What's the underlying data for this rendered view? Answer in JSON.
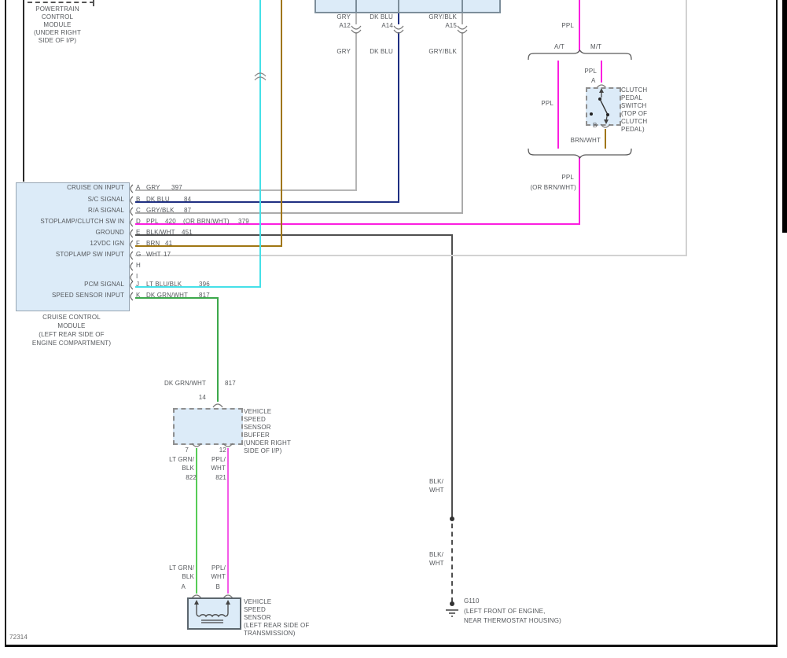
{
  "sheet_number": "72314",
  "pcm": {
    "label_lines": [
      "POWERTRAIN",
      "CONTROL",
      "MODULE",
      "(UNDER RIGHT",
      "SIDE OF I/P)"
    ]
  },
  "pcm_connector": {
    "pins": [
      {
        "color": "GRY",
        "pin": "A12",
        "wire_label": "GRY"
      },
      {
        "color": "DK BLU",
        "pin": "A14",
        "wire_label": "DK BLU"
      },
      {
        "color": "GRY/BLK",
        "pin": "A15",
        "wire_label": "GRY/BLK"
      }
    ]
  },
  "top_right": {
    "ppl_top": "PPL",
    "at_label": "A/T",
    "mt_label": "M/T",
    "ppl_at_branch": "PPL",
    "ppl_mt_branch": "PPL",
    "pin_a": "A",
    "pin_b": "B",
    "brn_wht": "BRN/WHT",
    "clutch_switch_lines": [
      "CLUTCH",
      "PEDAL",
      "SWITCH",
      "(TOP OF",
      "CLUTCH",
      "PEDAL)"
    ],
    "merge_color": "PPL",
    "merge_alt": "(OR BRN/WHT)"
  },
  "module": {
    "rows": [
      {
        "function": "CRUISE ON INPUT",
        "pin": "A",
        "color": "GRY",
        "circuit": "397"
      },
      {
        "function": "S/C SIGNAL",
        "pin": "B",
        "color": "DK BLU",
        "circuit": "84"
      },
      {
        "function": "R/A SIGNAL",
        "pin": "C",
        "color": "GRY/BLK",
        "circuit": "87"
      },
      {
        "function": "STOPLAMP/CLUTCH SW IN",
        "pin": "D",
        "color": "PPL",
        "circuit": "420",
        "alt_color": "(OR BRN/WHT)",
        "alt_circuit": "379"
      },
      {
        "function": "GROUND",
        "pin": "E",
        "color": "BLK/WHT",
        "circuit": "451"
      },
      {
        "function": "12VDC IGN",
        "pin": "F",
        "color": "BRN",
        "circuit": "41"
      },
      {
        "function": "STOPLAMP SW INPUT",
        "pin": "G",
        "color": "WHT",
        "circuit": "17"
      },
      {
        "function": "",
        "pin": "H",
        "color": "",
        "circuit": ""
      },
      {
        "function": "",
        "pin": "I",
        "color": "",
        "circuit": ""
      },
      {
        "function": "PCM SIGNAL",
        "pin": "J",
        "color": "LT BLU/BLK",
        "circuit": "396"
      },
      {
        "function": "SPEED SENSOR INPUT",
        "pin": "K",
        "color": "DK GRN/WHT",
        "circuit": "817"
      }
    ],
    "caption_lines": [
      "CRUISE CONTROL",
      "MODULE",
      "(LEFT REAR SIDE OF",
      "ENGINE COMPARTMENT)"
    ]
  },
  "vss_buffer": {
    "in_color": "DK GRN/WHT",
    "in_circuit": "817",
    "in_pin": "14",
    "label_lines": [
      "VEHICLE",
      "SPEED",
      "SENSOR",
      "BUFFER",
      "(UNDER RIGHT",
      "SIDE OF I/P)"
    ],
    "out_left_pin": "7",
    "out_right_pin": "12",
    "out_left_color_1": "LT GRN/",
    "out_left_color_2": "BLK",
    "out_left_circuit": "822",
    "out_right_color_1": "PPL/",
    "out_right_color_2": "WHT",
    "out_right_circuit": "821"
  },
  "vss": {
    "left_color_1": "LT GRN/",
    "left_color_2": "BLK",
    "right_color_1": "PPL/",
    "right_color_2": "WHT",
    "pin_a": "A",
    "pin_b": "B",
    "label_lines": [
      "VEHICLE",
      "SPEED",
      "SENSOR",
      "(LEFT REAR SIDE OF",
      "TRANSMISSION)"
    ]
  },
  "ground_path": {
    "upper_label_1": "BLK/",
    "upper_label_2": "WHT",
    "lower_label_1": "BLK/",
    "lower_label_2": "WHT",
    "ground_name": "G110",
    "ground_lines": [
      "(LEFT FRONT OF ENGINE,",
      "NEAR THERMOSTAT HOUSING)"
    ]
  },
  "colors": {
    "gry": "#b5b5b5",
    "dk_blu": "#203082",
    "gry_blk": "#ababab",
    "ppl": "#fb1fe0",
    "blk_wht": "#4f4f4f",
    "brn": "#a07612",
    "wht": "#d2d2d2",
    "lt_blu_blk": "#45e0e8",
    "dk_grn_wht": "#3ca84b",
    "lt_grn_blk": "#57cc57",
    "ppl_wht": "#f45ce8",
    "box_fill": "#dcebf8",
    "line": "#55585c"
  }
}
